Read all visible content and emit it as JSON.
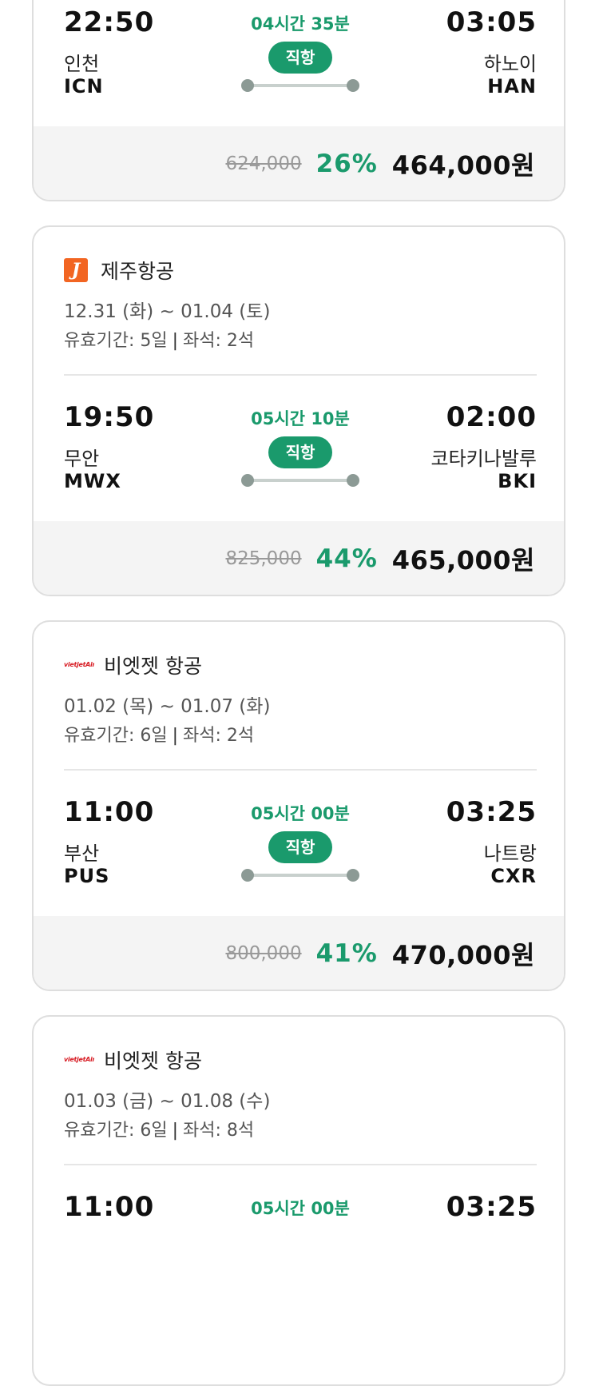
{
  "flights": [
    {
      "airline": "",
      "logo": "",
      "dates": "",
      "validity": {
        "period": "",
        "seats": ""
      },
      "departure": {
        "time": "22:50",
        "city": "인천",
        "code": "ICN"
      },
      "arrival": {
        "time": "03:05",
        "city": "하노이",
        "code": "HAN"
      },
      "duration": "04시간 35분",
      "type": "직항",
      "price": {
        "original": "624,000",
        "discount": "26%",
        "final": "464,000원"
      }
    },
    {
      "airline": "제주항공",
      "logo": "J",
      "dates": "12.31 (화) ~ 01.04 (토)",
      "validity": {
        "period": "유효기간: 5일",
        "seats": "좌석: 2석"
      },
      "departure": {
        "time": "19:50",
        "city": "무안",
        "code": "MWX"
      },
      "arrival": {
        "time": "02:00",
        "city": "코타키나발루",
        "code": "BKI"
      },
      "duration": "05시간 10분",
      "type": "직항",
      "price": {
        "original": "825,000",
        "discount": "44%",
        "final": "465,000원"
      }
    },
    {
      "airline": "비엣젯 항공",
      "logo": "vietjetAir.com",
      "dates": "01.02 (목) ~ 01.07 (화)",
      "validity": {
        "period": "유효기간: 6일",
        "seats": "좌석: 2석"
      },
      "departure": {
        "time": "11:00",
        "city": "부산",
        "code": "PUS"
      },
      "arrival": {
        "time": "03:25",
        "city": "나트랑",
        "code": "CXR"
      },
      "duration": "05시간 00분",
      "type": "직항",
      "price": {
        "original": "800,000",
        "discount": "41%",
        "final": "470,000원"
      }
    },
    {
      "airline": "비엣젯 항공",
      "logo": "vietjetAir.com",
      "dates": "01.03 (금) ~ 01.08 (수)",
      "validity": {
        "period": "유효기간: 6일",
        "seats": "좌석: 8석"
      },
      "departure": {
        "time": "11:00",
        "city": "",
        "code": ""
      },
      "arrival": {
        "time": "03:25",
        "city": "",
        "code": ""
      },
      "duration": "05시간 00분",
      "type": "",
      "price": {
        "original": "",
        "discount": "",
        "final": ""
      }
    }
  ],
  "colors": {
    "accent_green": "#1a9a6c",
    "jeju_orange": "#f26522",
    "vietjet_red": "#d71921"
  },
  "icons": {
    "validity_separator": "|"
  }
}
